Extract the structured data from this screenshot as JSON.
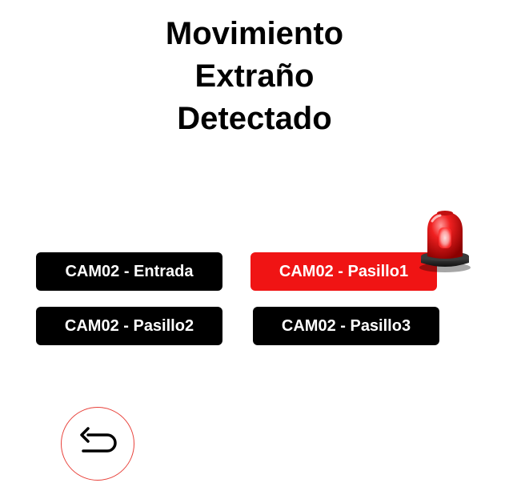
{
  "title": {
    "line1": "Movimiento",
    "line2": "Extraño",
    "line3": "Detectado"
  },
  "cameras": [
    {
      "label": "CAM02 - Entrada",
      "status": "normal",
      "color": "#000000"
    },
    {
      "label": "CAM02 - Pasillo1",
      "status": "alert",
      "color": "#f01414"
    },
    {
      "label": "CAM02 - Pasillo2",
      "status": "normal",
      "color": "#000000"
    },
    {
      "label": "CAM02 - Pasillo3",
      "status": "normal",
      "color": "#000000"
    }
  ],
  "icons": {
    "alarm": "siren-icon",
    "back": "back-arrow-icon"
  },
  "colors": {
    "alert": "#f01414",
    "back_button_border": "#e8413a"
  }
}
